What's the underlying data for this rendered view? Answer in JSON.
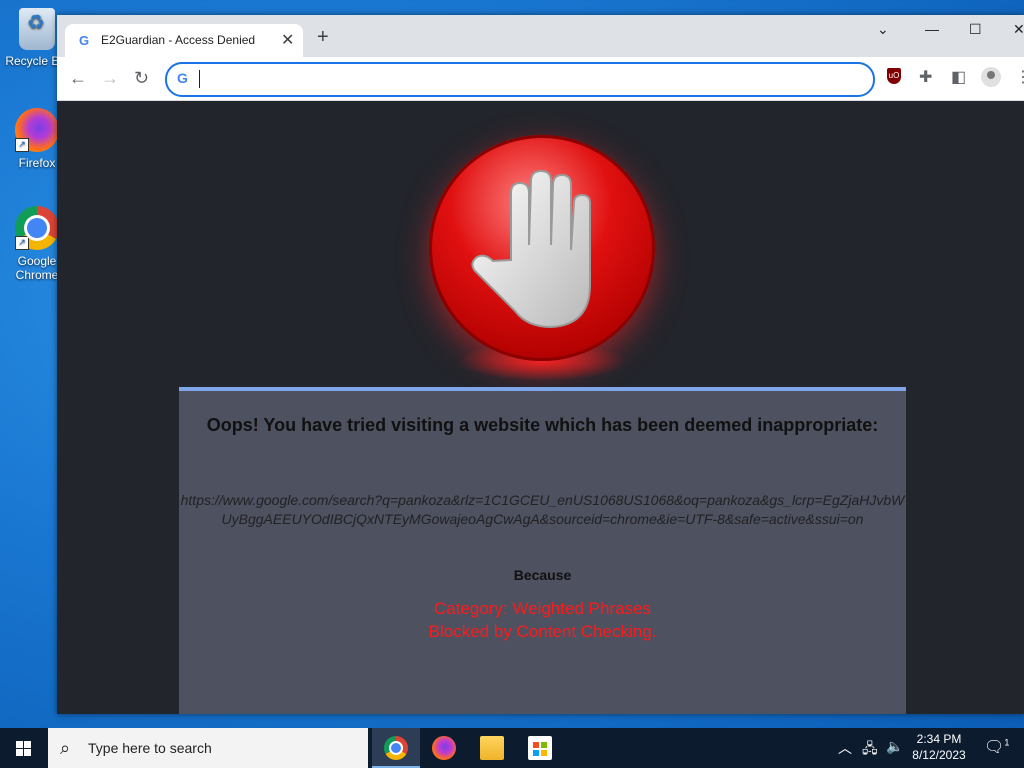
{
  "desktop": {
    "icons": [
      {
        "label": "Recycle Bin"
      },
      {
        "label": "Firefox"
      },
      {
        "label": "Google Chrome"
      }
    ]
  },
  "browser": {
    "tab": {
      "title": "E2Guardian - Access Denied",
      "favicon": "G"
    },
    "omnibox": {
      "value": "",
      "placeholder": "",
      "icon": "G"
    },
    "extensions": {
      "ublock_label": "uO"
    }
  },
  "page": {
    "heading": "Oops! You have tried visiting a website which has been deemed inappropriate:",
    "blocked_url": "https://www.google.com/search?q=pankoza&rlz=1C1GCEU_enUS1068US1068&oq=pankoza&gs_lcrp=EgZjaHJvbWUyBggAEEUYOdIBCjQxNTEyMGowajeoAgCwAgA&sourceid=chrome&ie=UTF-8&safe=active&ssui=on",
    "because_label": "Because",
    "category_line": "Category: Weighted Phrases",
    "reason_line": "Blocked by Content Checking.",
    "accent_color": "#ff1a1a"
  },
  "taskbar": {
    "search_placeholder": "Type here to search",
    "time": "2:34 PM",
    "date": "8/12/2023",
    "notification_count": "1"
  }
}
